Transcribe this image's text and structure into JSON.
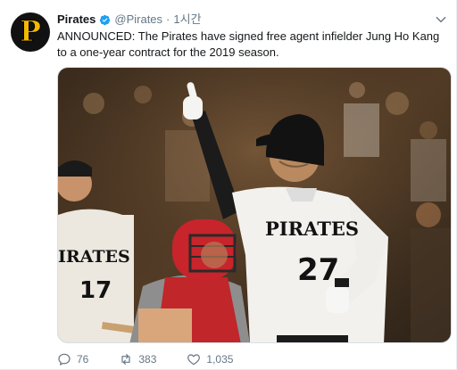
{
  "account": {
    "name": "Pirates",
    "handle": "@Pirates",
    "separator": "·",
    "time": "1시간",
    "avatar_letter": "P",
    "verified": true
  },
  "tweet": {
    "text": "ANNOUNCED: The Pirates have signed free agent infielder Jung Ho Kang to a one-year contract for the 2019 season."
  },
  "media": {
    "jersey_wordmark": "PIRATES",
    "jersey_number": "27",
    "background_wordmark": "IRATES",
    "background_number": "17"
  },
  "actions": {
    "replies": "76",
    "retweets": "383",
    "likes": "1,035"
  },
  "colors": {
    "brand_gold": "#f5b800",
    "text": "#14171a",
    "muted": "#657786",
    "verified_blue": "#1da1f2"
  },
  "icons": {
    "verified": "verified-badge-icon",
    "menu": "chevron-down-icon",
    "reply": "reply-icon",
    "retweet": "retweet-icon",
    "like": "heart-icon"
  }
}
